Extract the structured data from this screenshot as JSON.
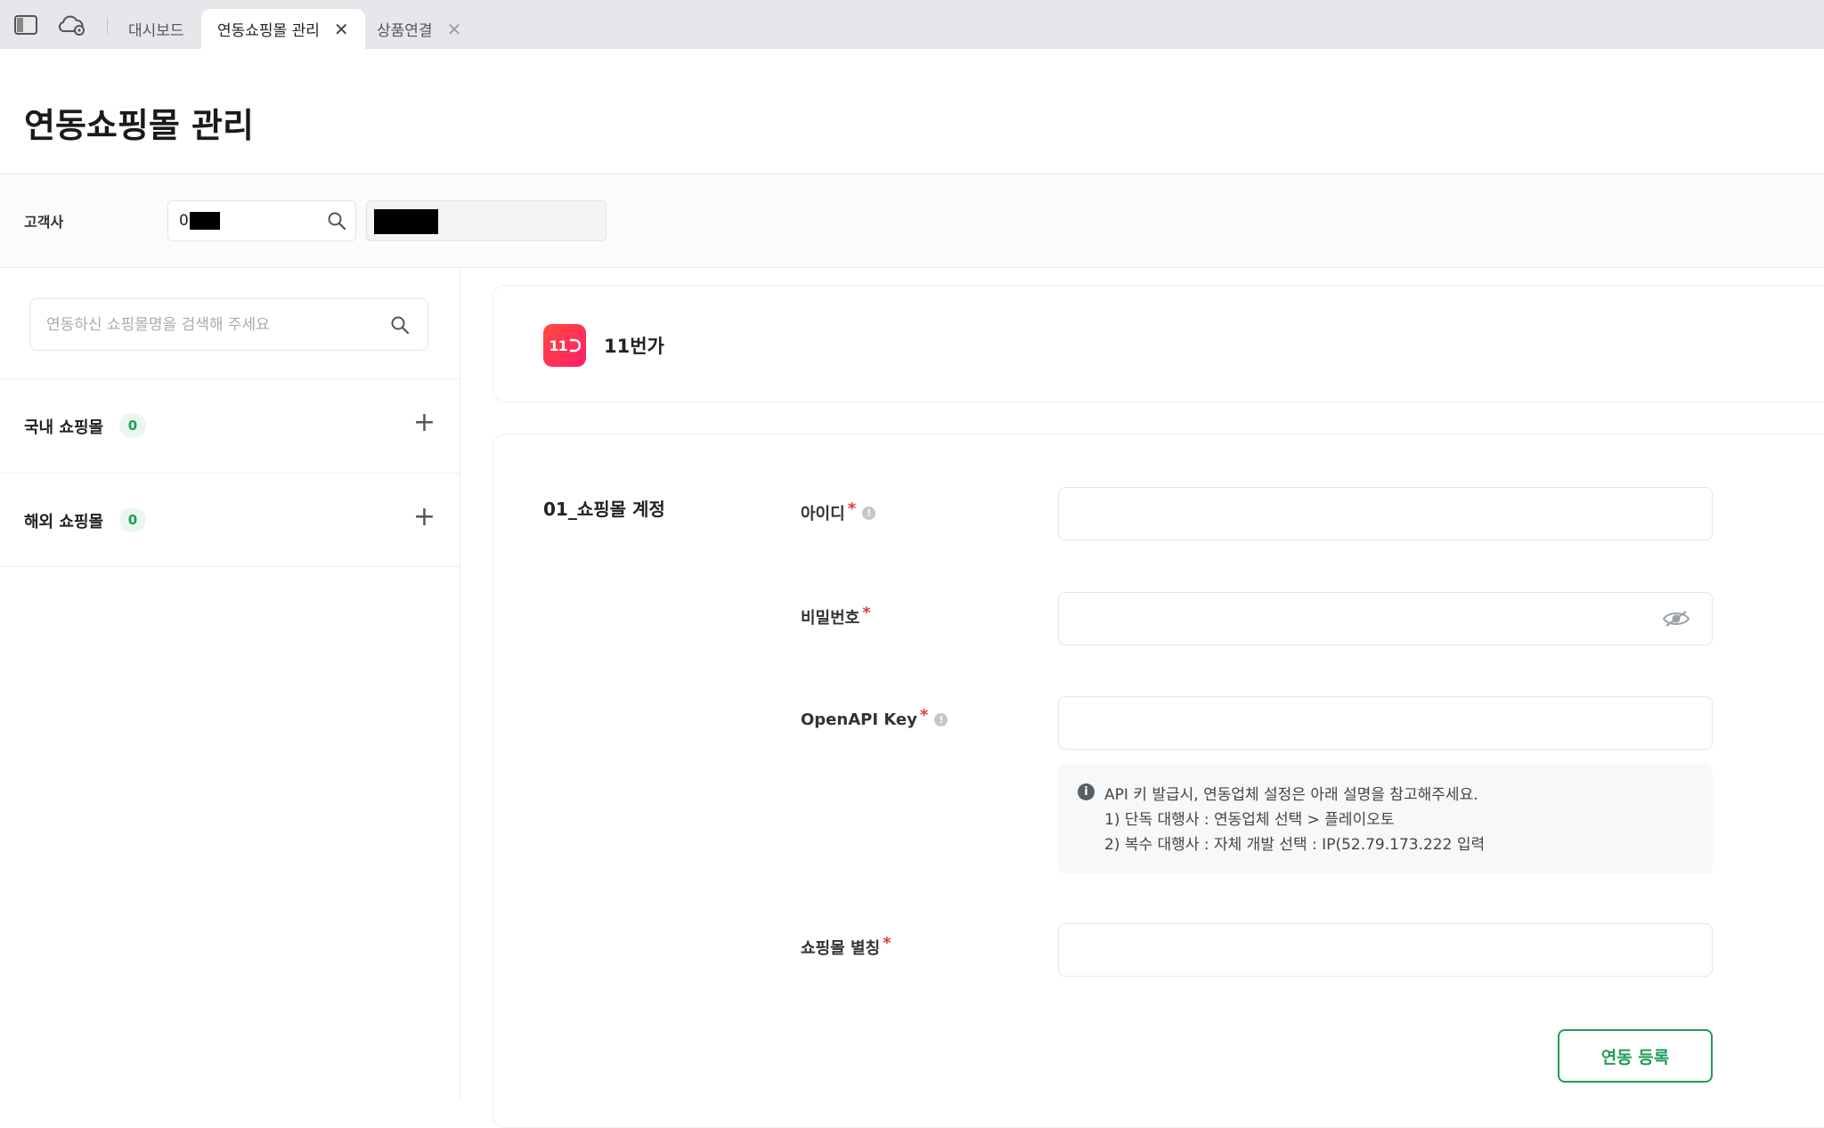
{
  "tabs": [
    {
      "label": "대시보드",
      "active": false,
      "closable": false
    },
    {
      "label": "연동쇼핑몰 관리",
      "active": true,
      "closable": true
    },
    {
      "label": "상품연결",
      "active": false,
      "closable": true
    }
  ],
  "tabbar": {
    "icons": [
      "sidebar-toggle-icon",
      "cloud-settings-icon"
    ],
    "close_glyph": "✕"
  },
  "page": {
    "title": "연동쇼핑몰 관리"
  },
  "filter": {
    "customer_label": "고객사",
    "customer_code_visible": "0"
  },
  "sidebar": {
    "search_placeholder": "연동하신 쇼핑몰명을 검색해 주세요",
    "sections": [
      {
        "label": "국내 쇼핑몰",
        "count": "0",
        "action": "+"
      },
      {
        "label": "해외 쇼핑몰",
        "count": "0",
        "action": "+"
      }
    ]
  },
  "mall": {
    "logo_text": "11",
    "name": "11번가"
  },
  "form": {
    "section_title": "01_쇼핑몰 계정",
    "required_mark": "*",
    "fields": {
      "id": {
        "label": "아이디",
        "value": ""
      },
      "password": {
        "label": "비밀번호",
        "value": ""
      },
      "openapi": {
        "label": "OpenAPI Key",
        "value": ""
      },
      "alias": {
        "label": "쇼핑몰 별칭",
        "value": ""
      }
    },
    "help": {
      "icon": "i",
      "lines": [
        "API 키 발급시, 연동업체 설정은 아래 설명을 참고해주세요.",
        "1) 단독 대행사 : 연동업체 선택 > 플레이오토",
        "2) 복수 대행사 : 자체 개발 선택 : IP(52.79.173.222 입력"
      ]
    },
    "submit_label": "연동 등록"
  },
  "colors": {
    "accent": "#1f9d55",
    "required": "#e03b3b",
    "brand_11st": "#ff2d55"
  }
}
